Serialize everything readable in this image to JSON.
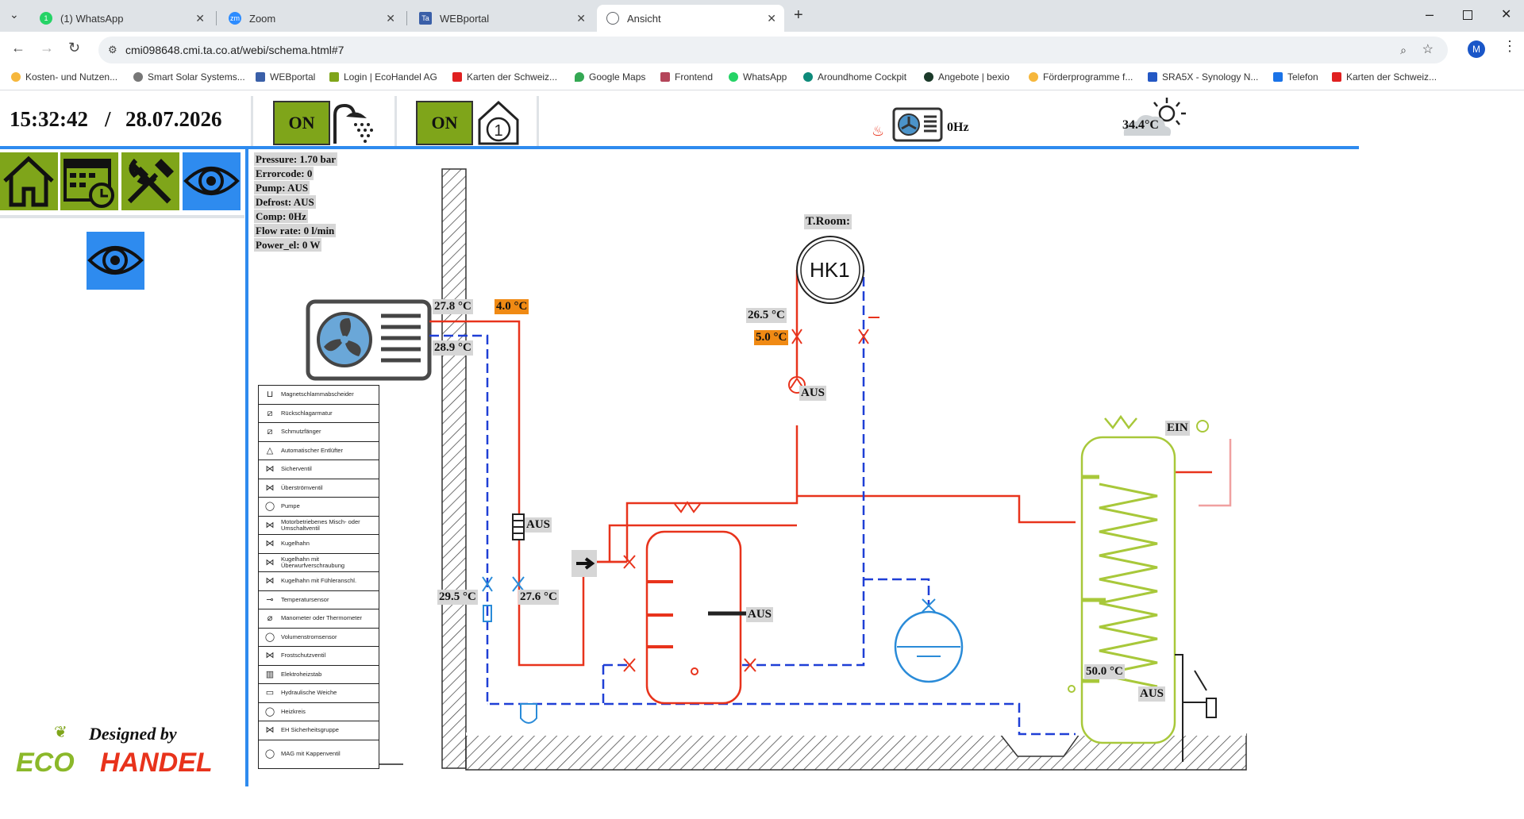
{
  "browser": {
    "tabs": [
      {
        "title": "(1) WhatsApp",
        "icon": "whatsapp-icon",
        "color": "#25d366"
      },
      {
        "title": "Zoom",
        "icon": "zoom-icon",
        "color": "#2d8cff"
      },
      {
        "title": "WEBportal",
        "icon": "ta-icon",
        "color": "#3a5fa8"
      },
      {
        "title": "Ansicht",
        "icon": "globe-icon",
        "color": "#5f6368"
      }
    ],
    "new_tab": "+",
    "url": "cmi098648.cmi.ta.co.at/webi/schema.html#7",
    "profile_initial": "M",
    "bookmarks": [
      "Kosten- und Nutzen...",
      "Smart Solar Systems...",
      "WEBportal",
      "Login | EcoHandel AG",
      "Karten der Schweiz...",
      "Google Maps",
      "Frontend",
      "WhatsApp",
      "Aroundhome Cockpit",
      "Angebote | bexio",
      "Förderprogramme f...",
      "SRA5X - Synology N...",
      "Telefon",
      "Karten der Schweiz..."
    ]
  },
  "header": {
    "time": "15:32:42",
    "sep": "/",
    "date": "28.07.2026",
    "on1": "ON",
    "on2": "ON",
    "hp_freq": "0Hz",
    "outdoor_temp": "34.4°C"
  },
  "status": {
    "pressure": "Pressure: 1.70 bar",
    "errorcode": "Errorcode: 0",
    "pump": "Pump: AUS",
    "defrost": "Defrost: AUS",
    "comp": "Comp: 0Hz",
    "flow": "Flow rate: 0 l/min",
    "power": "Power_el: 0 W"
  },
  "schema": {
    "t_hp_flow": "27.8 °C",
    "t_hp_return": "28.9 °C",
    "t_outdoor": "4.0 °C",
    "t_room_label": "T.Room:",
    "hk1": "HK1",
    "t_hk_flow": "26.5 °C",
    "t_hk_set": "5.0 °C",
    "pump_hk": "AUS",
    "heater_state": "AUS",
    "t_bottom_left": "29.5 °C",
    "t_bottom_right": "27.6 °C",
    "buffer_heater": "AUS",
    "dhw_state": "EIN",
    "t_dhw": "50.0 °C",
    "dhw_heater": "AUS"
  },
  "legend": [
    {
      "label": "Magnetschlammabscheider",
      "sym": "⊔"
    },
    {
      "label": "Rückschlagarmatur",
      "sym": "⧄"
    },
    {
      "label": "Schmutzfänger",
      "sym": "⧄"
    },
    {
      "label": "Automatischer Entlüfter",
      "sym": "△"
    },
    {
      "label": "Sicherventil",
      "sym": "⋈"
    },
    {
      "label": "Überströmventil",
      "sym": "⋈"
    },
    {
      "label": "Pumpe",
      "sym": "◯"
    },
    {
      "label": "Motorbetriebenes Misch- oder Umschaltventil",
      "sym": "⋈"
    },
    {
      "label": "Kugelhahn",
      "sym": "⋈"
    },
    {
      "label": "Kugelhahn mit Überwurfverschraubung",
      "sym": "⋈"
    },
    {
      "label": "Kugelhahn mit Fühleranschl.",
      "sym": "⋈"
    },
    {
      "label": "Temperatursensor",
      "sym": "⊸"
    },
    {
      "label": "Manometer oder Thermometer",
      "sym": "⌀"
    },
    {
      "label": "Volumenstromsensor",
      "sym": "◯"
    },
    {
      "label": "Frostschutzventil",
      "sym": "⋈"
    },
    {
      "label": "Elektroheizstab",
      "sym": "▥"
    },
    {
      "label": "Hydraulische Weiche",
      "sym": "▭"
    },
    {
      "label": "Heizkreis",
      "sym": "◯"
    },
    {
      "label": "EH Sicherheitsgruppe",
      "sym": "⋈"
    },
    {
      "label": "MAG mit Kappenventil",
      "sym": "◯"
    }
  ],
  "logo": {
    "designed_by": "Designed by",
    "eco": "ECO",
    "handel": "HANDEL"
  },
  "colors": {
    "accent_blue": "#2e8bef",
    "on_green": "#7fa51a",
    "pipe_red": "#e8331c",
    "pipe_blue": "#1f3fd6",
    "tank_green": "#a8c83a",
    "orange": "#f08a14"
  }
}
